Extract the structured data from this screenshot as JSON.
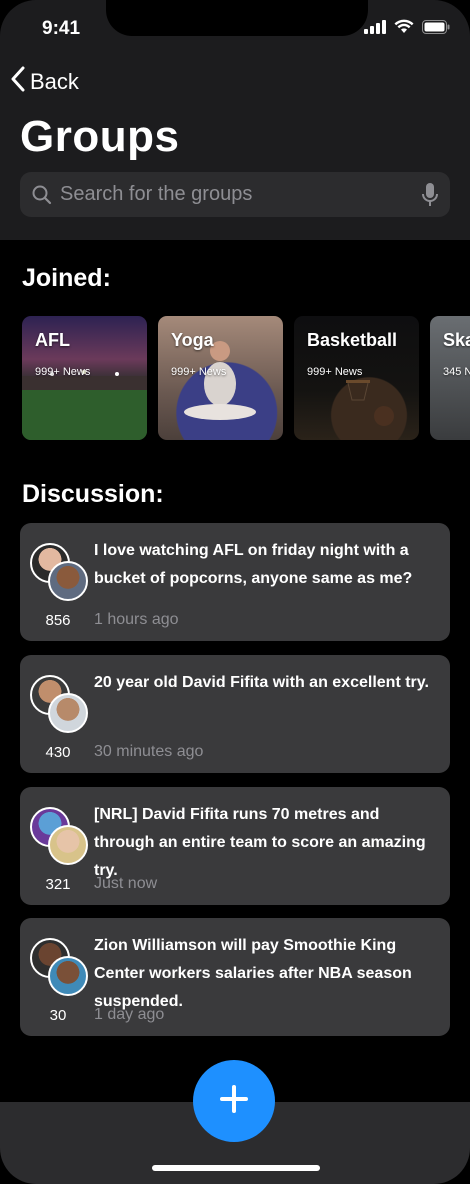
{
  "status": {
    "time": "9:41"
  },
  "nav": {
    "back_label": "Back"
  },
  "page": {
    "title": "Groups"
  },
  "search": {
    "placeholder": "Search for the groups"
  },
  "sections": {
    "joined_title": "Joined:",
    "discussion_title": "Discussion:"
  },
  "groups": [
    {
      "name": "AFL",
      "count": "999+ News"
    },
    {
      "name": "Yoga",
      "count": "999+ News"
    },
    {
      "name": "Basketball",
      "count": "999+ News"
    },
    {
      "name": "Ska",
      "count": "345 N"
    }
  ],
  "discussions": [
    {
      "text": "I love watching AFL on friday night with a bucket of popcorns, anyone same as me?",
      "count": "856",
      "time": "1 hours ago"
    },
    {
      "text": "20 year old David Fifita with an excellent try.",
      "count": "430",
      "time": "30 minutes ago"
    },
    {
      "text": "[NRL] David Fifita runs 70 metres and through an entire team to score an amazing try.",
      "count": "321",
      "time": "Just now"
    },
    {
      "text": "Zion Williamson will pay Smoothie King Center workers salaries after NBA season suspended.",
      "count": "30",
      "time": "1 day ago"
    }
  ],
  "colors": {
    "accent": "#1e90ff",
    "card": "#3a3a3c",
    "header": "#1c1c1e"
  },
  "icons": [
    "signal-icon",
    "wifi-icon",
    "battery-icon",
    "chevron-left-icon",
    "search-icon",
    "microphone-icon",
    "plus-icon"
  ]
}
